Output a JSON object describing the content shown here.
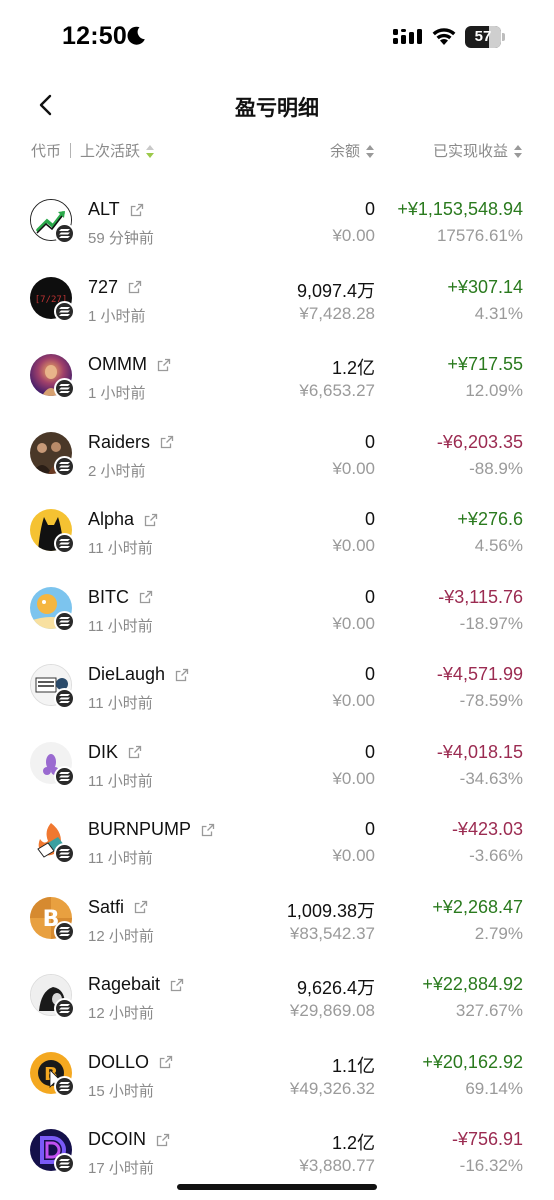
{
  "status": {
    "time": "12:50",
    "battery": "57"
  },
  "header": {
    "title": "盈亏明细"
  },
  "columns": {
    "token": "代币",
    "last_active": "上次活跃",
    "balance": "余额",
    "realized": "已实现收益"
  },
  "colors": {
    "gain": "#2a7a1e",
    "loss": "#9b2b51",
    "muted": "#9a9a9a",
    "sort_active": "#9cc94a"
  },
  "tokens": [
    {
      "symbol": "ALT",
      "time": "59 分钟前",
      "balance": "0",
      "value": "¥0.00",
      "pnl": "+¥1,153,548.94",
      "pct": "17576.61%",
      "dir": "gain"
    },
    {
      "symbol": "727",
      "time": "1 小时前",
      "balance": "9,097.4万",
      "value": "¥7,428.28",
      "pnl": "+¥307.14",
      "pct": "4.31%",
      "dir": "gain"
    },
    {
      "symbol": "OMMM",
      "time": "1 小时前",
      "balance": "1.2亿",
      "value": "¥6,653.27",
      "pnl": "+¥717.55",
      "pct": "12.09%",
      "dir": "gain"
    },
    {
      "symbol": "Raiders",
      "time": "2 小时前",
      "balance": "0",
      "value": "¥0.00",
      "pnl": "-¥6,203.35",
      "pct": "-88.9%",
      "dir": "loss"
    },
    {
      "symbol": "Alpha",
      "time": "11 小时前",
      "balance": "0",
      "value": "¥0.00",
      "pnl": "+¥276.6",
      "pct": "4.56%",
      "dir": "gain"
    },
    {
      "symbol": "BITC",
      "time": "11 小时前",
      "balance": "0",
      "value": "¥0.00",
      "pnl": "-¥3,115.76",
      "pct": "-18.97%",
      "dir": "loss"
    },
    {
      "symbol": "DieLaugh",
      "time": "11 小时前",
      "balance": "0",
      "value": "¥0.00",
      "pnl": "-¥4,571.99",
      "pct": "-78.59%",
      "dir": "loss"
    },
    {
      "symbol": "DIK",
      "time": "11 小时前",
      "balance": "0",
      "value": "¥0.00",
      "pnl": "-¥4,018.15",
      "pct": "-34.63%",
      "dir": "loss"
    },
    {
      "symbol": "BURNPUMP",
      "time": "11 小时前",
      "balance": "0",
      "value": "¥0.00",
      "pnl": "-¥423.03",
      "pct": "-3.66%",
      "dir": "loss"
    },
    {
      "symbol": "Satfi",
      "time": "12 小时前",
      "balance": "1,009.38万",
      "value": "¥83,542.37",
      "pnl": "+¥2,268.47",
      "pct": "2.79%",
      "dir": "gain"
    },
    {
      "symbol": "Ragebait",
      "time": "12 小时前",
      "balance": "9,626.4万",
      "value": "¥29,869.08",
      "pnl": "+¥22,884.92",
      "pct": "327.67%",
      "dir": "gain"
    },
    {
      "symbol": "DOLLO",
      "time": "15 小时前",
      "balance": "1.1亿",
      "value": "¥49,326.32",
      "pnl": "+¥20,162.92",
      "pct": "69.14%",
      "dir": "gain"
    },
    {
      "symbol": "DCOIN",
      "time": "17 小时前",
      "balance": "1.2亿",
      "value": "¥3,880.77",
      "pnl": "-¥756.91",
      "pct": "-16.32%",
      "dir": "loss"
    }
  ]
}
